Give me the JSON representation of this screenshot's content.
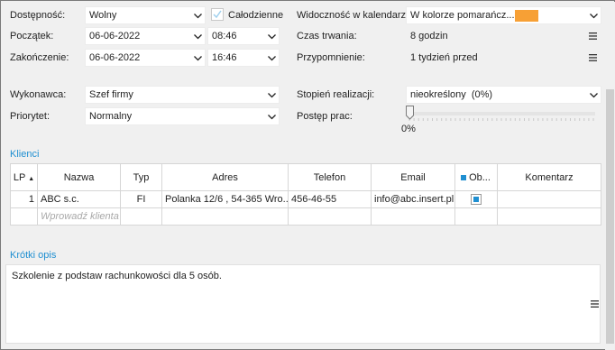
{
  "form": {
    "availability_label": "Dostępność:",
    "availability_value": "Wolny",
    "all_day_label": "Całodzienne",
    "start_label": "Początek:",
    "start_date": "06-06-2022",
    "start_time": "08:46",
    "end_label": "Zakończenie:",
    "end_date": "06-06-2022",
    "end_time": "16:46",
    "calendar_visibility_label": "Widoczność w kalendarzu:",
    "calendar_visibility_value": "W kolorze pomarańcz...",
    "calendar_color": "#f7a035",
    "duration_label": "Czas trwania:",
    "duration_value": "8 godzin",
    "reminder_label": "Przypomnienie:",
    "reminder_value": "1 tydzień przed",
    "performer_label": "Wykonawca:",
    "performer_value": "Szef firmy",
    "completion_label": "Stopień realizacji:",
    "completion_value": "nieokreślony  (0%)",
    "priority_label": "Priorytet:",
    "priority_value": "Normalny",
    "progress_label": "Postęp prac:",
    "progress_value_text": "0%",
    "progress_fraction": 0
  },
  "clients": {
    "title": "Klienci",
    "columns": [
      "LP",
      "Nazwa",
      "Typ",
      "Adres",
      "Telefon",
      "Email",
      "Ob...",
      "Komentarz"
    ],
    "sort_indicator": "▲",
    "rows": [
      {
        "lp": "1",
        "name": "ABC s.c.",
        "type": "FI",
        "address": "Polanka  12/6 , 54-365 Wro...",
        "phone": "456-46-55",
        "email": "info@abc.insert.pl",
        "comment": ""
      }
    ],
    "new_row_placeholder": "Wprowadź klienta"
  },
  "description": {
    "title": "Krótki opis",
    "text": "Szkolenie z podstaw rachunkowości dla 5 osób."
  },
  "colors": {
    "accent": "#1f8fd1",
    "window_bg": "#f0f0f0"
  },
  "icons": {
    "dropdown": "chevron-down-icon",
    "menu": "hamburger-menu-icon",
    "checkbox": "checkmark-icon"
  }
}
